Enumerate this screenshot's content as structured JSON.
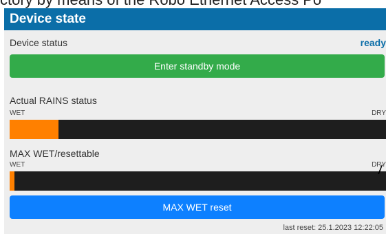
{
  "page_top_text": "ctory by means of the Robo Ethernet Access Po",
  "panel": {
    "title": "Device state",
    "device_status": {
      "label": "Device status",
      "value": "ready"
    },
    "standby_button": "Enter standby mode",
    "rains": {
      "title": "Actual RAINS status",
      "scale_left": "WET",
      "scale_right": "DRY",
      "level_fraction": 0.13
    },
    "maxwet": {
      "title": "MAX WET/resettable",
      "scale_left": "WET",
      "scale_right": "DRY",
      "level_fraction": 0.012
    },
    "reset_button": "MAX WET reset",
    "last_reset": "last reset: 25.1.2023 12:22:05"
  },
  "colors": {
    "header": "#0b6ea8",
    "standby_button": "#33ab4a",
    "reset_button": "#0d80ff",
    "bar_fill": "#ff8000",
    "bar_track": "#1e1e1e"
  }
}
